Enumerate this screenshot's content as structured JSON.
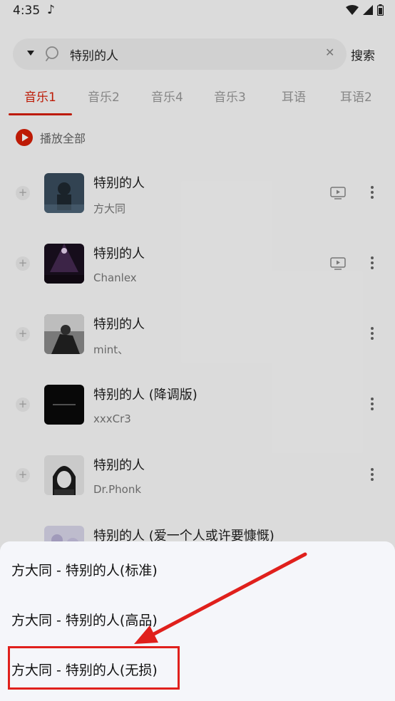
{
  "status_bar": {
    "time": "4:35"
  },
  "search": {
    "query": "特别的人",
    "button_label": "搜索"
  },
  "tabs": [
    {
      "label": "音乐1",
      "active": true
    },
    {
      "label": "音乐2",
      "active": false
    },
    {
      "label": "音乐4",
      "active": false
    },
    {
      "label": "音乐3",
      "active": false
    },
    {
      "label": "耳语",
      "active": false
    },
    {
      "label": "耳语2",
      "active": false
    }
  ],
  "play_all": {
    "label": "播放全部"
  },
  "songs": [
    {
      "title": "特别的人",
      "artist": "方大同",
      "has_mv": true
    },
    {
      "title": "特别的人",
      "artist": "Chanlex",
      "has_mv": true
    },
    {
      "title": "特别的人",
      "artist": "mint、",
      "has_mv": false
    },
    {
      "title": "特别的人 (降调版)",
      "artist": "xxxCr3",
      "has_mv": false
    },
    {
      "title": "特别的人",
      "artist": "Dr.Phonk",
      "has_mv": false
    },
    {
      "title": "特别的人 (爱一个人或许要慷慨)",
      "artist": "",
      "has_mv": false
    }
  ],
  "quality_sheet": {
    "options": [
      {
        "label": "方大同 - 特别的人(标准)"
      },
      {
        "label": "方大同 - 特别的人(高品)"
      },
      {
        "label": "方大同 - 特别的人(无损)"
      }
    ]
  },
  "colors": {
    "accent": "#d81e06",
    "annotation": "#e0201c"
  }
}
